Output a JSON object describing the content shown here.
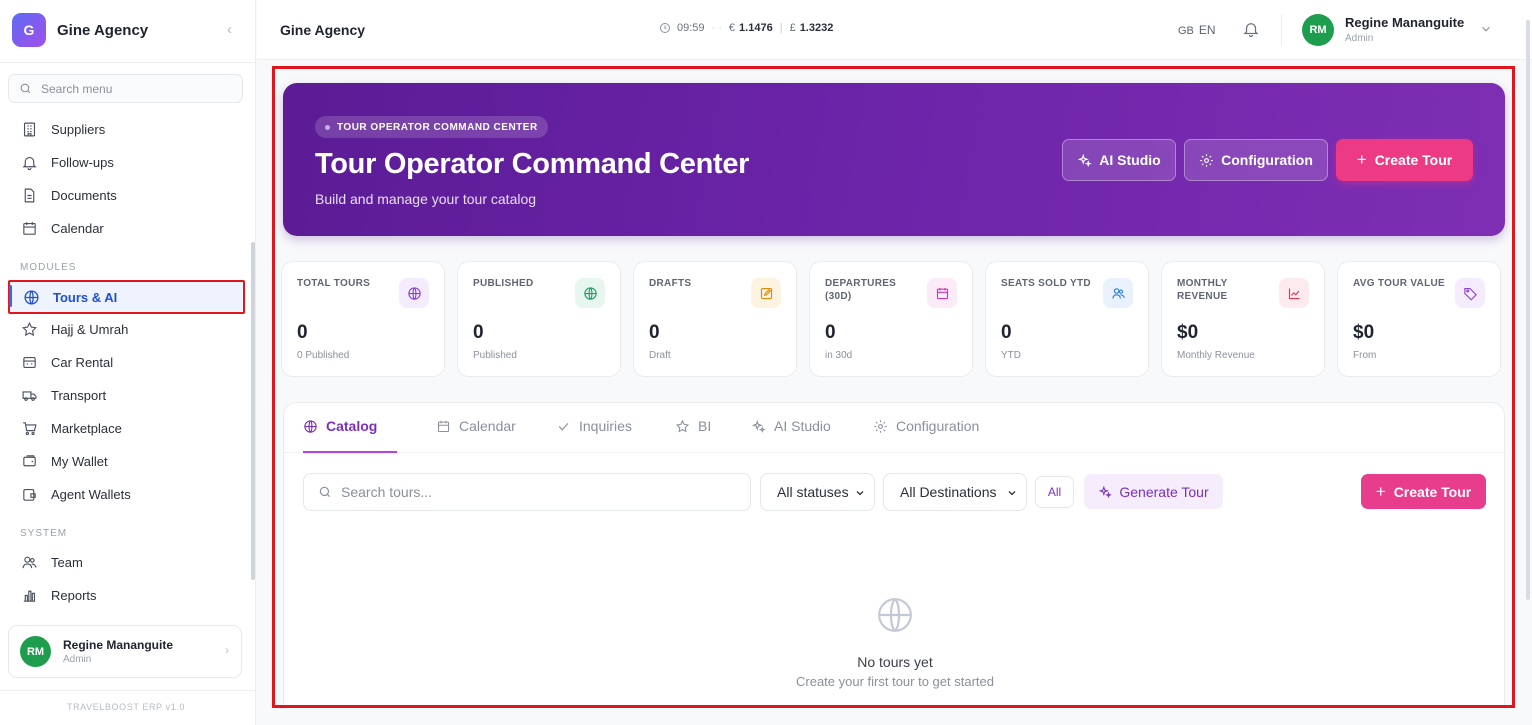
{
  "sidebar": {
    "brand_initial": "G",
    "brand_name": "Gine Agency",
    "search_placeholder": "Search menu",
    "items_top": [
      {
        "label": "Suppliers",
        "icon": "building-icon"
      },
      {
        "label": "Follow-ups",
        "icon": "bell-icon"
      },
      {
        "label": "Documents",
        "icon": "document-icon"
      },
      {
        "label": "Calendar",
        "icon": "calendar-icon"
      }
    ],
    "section_modules": "MODULES",
    "items_modules": [
      {
        "label": "Tours & AI",
        "icon": "globe-icon",
        "active": true
      },
      {
        "label": "Hajj & Umrah",
        "icon": "star-icon"
      },
      {
        "label": "Car Rental",
        "icon": "car-icon"
      },
      {
        "label": "Transport",
        "icon": "truck-icon"
      },
      {
        "label": "Marketplace",
        "icon": "cart-icon"
      },
      {
        "label": "My Wallet",
        "icon": "wallet-icon"
      },
      {
        "label": "Agent Wallets",
        "icon": "wallet-card-icon"
      }
    ],
    "section_system": "SYSTEM",
    "items_system": [
      {
        "label": "Team",
        "icon": "users-icon"
      },
      {
        "label": "Reports",
        "icon": "bar-chart-icon"
      }
    ],
    "user": {
      "initials": "RM",
      "name": "Regine Mananguite",
      "role": "Admin"
    },
    "version": "TRAVELBOOST ERP v1.0"
  },
  "topbar": {
    "title": "Gine Agency",
    "time": "09:59",
    "dots": "· ·",
    "eur_symbol": "€",
    "eur_rate": "1.1476",
    "gbp_symbol": "£",
    "gbp_rate": "1.3232",
    "lang_flag": "GB",
    "lang_code": "EN",
    "user": {
      "initials": "RM",
      "name": "Regine Mananguite",
      "role": "Admin"
    }
  },
  "hero": {
    "pill": "TOUR OPERATOR COMMAND CENTER",
    "title": "Tour Operator Command Center",
    "subtitle": "Build and manage your tour catalog",
    "buttons": {
      "ai_studio": "AI Studio",
      "configuration": "Configuration",
      "create_tour": "Create Tour",
      "plus": "+"
    }
  },
  "stats": [
    {
      "label": "TOTAL TOURS",
      "value": "0",
      "sub": "0 Published",
      "icon": "globe-icon",
      "color": "#8b3fd6",
      "bg": "#f4ecfc"
    },
    {
      "label": "PUBLISHED",
      "value": "0",
      "sub": "Published",
      "icon": "globe-icon",
      "color": "#1f9d63",
      "bg": "#e7f6ee"
    },
    {
      "label": "DRAFTS",
      "value": "0",
      "sub": "Draft",
      "icon": "edit-icon",
      "color": "#d98a0b",
      "bg": "#fdf3e1"
    },
    {
      "label": "DEPARTURES (30D)",
      "value": "0",
      "sub": "in 30d",
      "icon": "calendar-icon",
      "color": "#c935b8",
      "bg": "#fbeaf8"
    },
    {
      "label": "SEATS SOLD YTD",
      "value": "0",
      "sub": "YTD",
      "icon": "users-icon",
      "color": "#2f7fd6",
      "bg": "#e8f1fc"
    },
    {
      "label": "MONTHLY REVENUE",
      "value": "$0",
      "sub": "Monthly Revenue",
      "icon": "trend-icon",
      "color": "#e0365a",
      "bg": "#fdeaee"
    },
    {
      "label": "AVG TOUR VALUE",
      "value": "$0",
      "sub": "From",
      "icon": "tag-icon",
      "color": "#8b3fd6",
      "bg": "#f4ecfc"
    }
  ],
  "catalog": {
    "tabs": [
      {
        "label": "Catalog",
        "icon": "globe-icon",
        "active": true
      },
      {
        "label": "Calendar",
        "icon": "calendar-icon"
      },
      {
        "label": "Inquiries",
        "icon": "check-icon"
      },
      {
        "label": "BI",
        "icon": "star-icon"
      },
      {
        "label": "AI Studio",
        "icon": "sparkles-icon"
      },
      {
        "label": "Configuration",
        "icon": "gear-icon"
      }
    ],
    "search_placeholder": "Search tours...",
    "status_select": "All statuses",
    "destination_select": "All Destinations",
    "all_button": "All",
    "generate_button": "Generate Tour",
    "create_button": "Create Tour",
    "create_plus": "+",
    "empty_title": "No tours yet",
    "empty_subtitle": "Create your first tour to get started"
  },
  "colors": {
    "accent_purple": "#7b2fbf",
    "accent_pink": "#e83c8c",
    "active_blue": "#1e4fd6",
    "highlight_red": "#e0161c"
  }
}
